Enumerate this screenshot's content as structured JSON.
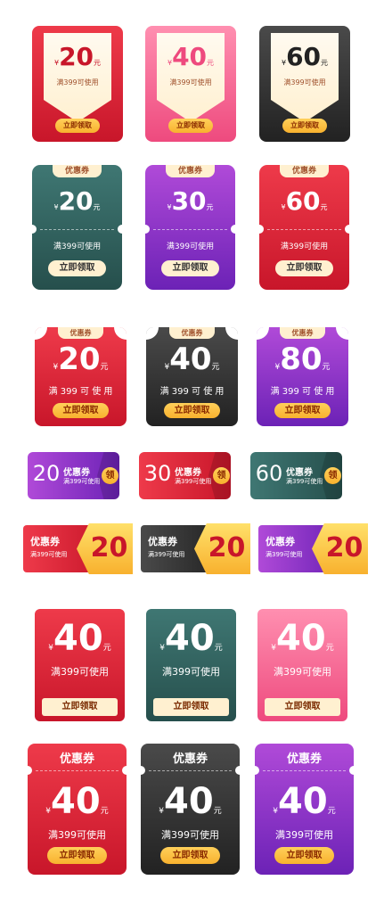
{
  "yen": "¥",
  "yuan": "元",
  "rows": [
    {
      "items": [
        {
          "theme": "red",
          "amount": "20",
          "condition": "满399可使用",
          "button": "立即领取"
        },
        {
          "theme": "pink",
          "amount": "40",
          "condition": "满399可使用",
          "button": "立即领取"
        },
        {
          "theme": "black",
          "amount": "60",
          "condition": "满399可使用",
          "button": "立即领取"
        }
      ]
    },
    {
      "items": [
        {
          "theme": "teal",
          "title": "优惠券",
          "amount": "20",
          "condition": "满399可使用",
          "button": "立即领取"
        },
        {
          "theme": "purple",
          "title": "优惠券",
          "amount": "30",
          "condition": "满399可使用",
          "button": "立即领取"
        },
        {
          "theme": "red",
          "title": "优惠券",
          "amount": "60",
          "condition": "满399可使用",
          "button": "立即领取"
        }
      ]
    },
    {
      "items": [
        {
          "theme": "red",
          "title": "优惠券",
          "amount": "20",
          "condition": "满 399 可 使 用",
          "button": "立即领取"
        },
        {
          "theme": "black",
          "title": "优惠券",
          "amount": "40",
          "condition": "满 399 可 使 用",
          "button": "立即领取"
        },
        {
          "theme": "purple",
          "title": "优惠券",
          "amount": "80",
          "condition": "满 399 可 使 用",
          "button": "立即领取"
        }
      ]
    },
    {
      "items": [
        {
          "theme": "purple",
          "amount": "20",
          "title": "优惠券",
          "condition": "满399可使用",
          "button": "领"
        },
        {
          "theme": "red",
          "amount": "30",
          "title": "优惠券",
          "condition": "满399可使用",
          "button": "领"
        },
        {
          "theme": "teal",
          "amount": "60",
          "title": "优惠券",
          "condition": "满399可使用",
          "button": "领"
        }
      ]
    },
    {
      "items": [
        {
          "theme": "red",
          "title": "优惠券",
          "condition": "满399可使用",
          "amount": "20"
        },
        {
          "theme": "black",
          "title": "优惠券",
          "condition": "满399可使用",
          "amount": "20"
        },
        {
          "theme": "purple",
          "title": "优惠券",
          "condition": "满399可使用",
          "amount": "20"
        }
      ]
    },
    {
      "items": [
        {
          "theme": "red",
          "amount": "40",
          "condition": "满399可使用",
          "button": "立即领取"
        },
        {
          "theme": "teal",
          "amount": "40",
          "condition": "满399可使用",
          "button": "立即领取"
        },
        {
          "theme": "pink",
          "amount": "40",
          "condition": "满399可使用",
          "button": "立即领取"
        }
      ]
    },
    {
      "items": [
        {
          "theme": "red",
          "title": "优惠券",
          "amount": "40",
          "condition": "满399可使用",
          "button": "立即领取"
        },
        {
          "theme": "black",
          "title": "优惠券",
          "amount": "40",
          "condition": "满399可使用",
          "button": "立即领取"
        },
        {
          "theme": "purple",
          "title": "优惠券",
          "amount": "40",
          "condition": "满399可使用",
          "button": "立即领取"
        }
      ]
    }
  ],
  "colors": {
    "red": [
      "#ee3a4a",
      "#c8162a"
    ],
    "pink": [
      "#ff8fb0",
      "#ee4a7e"
    ],
    "black": [
      "#4a4a4a",
      "#222222"
    ],
    "teal": [
      "#3f7773",
      "#264f4c"
    ],
    "purple": [
      "#b04ad8",
      "#6c22b6"
    ],
    "gold": "#f8b12e",
    "cream": "#fff0d0"
  }
}
